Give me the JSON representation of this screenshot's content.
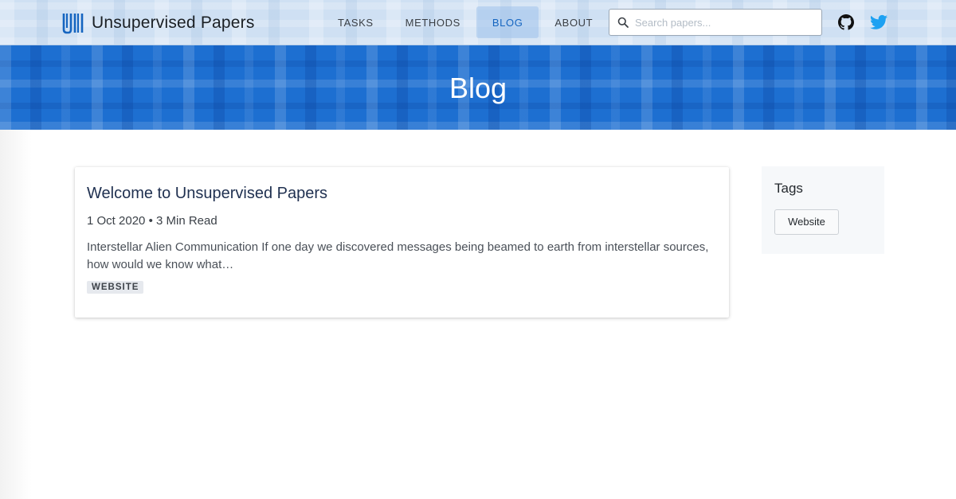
{
  "brand": {
    "name": "Unsupervised Papers",
    "accent_color": "#1565c0"
  },
  "nav": {
    "items": [
      {
        "label": "TASKS",
        "active": false
      },
      {
        "label": "METHODS",
        "active": false
      },
      {
        "label": "BLOG",
        "active": true
      },
      {
        "label": "ABOUT",
        "active": false
      }
    ]
  },
  "search": {
    "placeholder": "Search papers...",
    "value": ""
  },
  "social": {
    "icons": [
      "github-icon",
      "twitter-icon"
    ],
    "twitter_color": "#1da1f2"
  },
  "hero": {
    "title": "Blog",
    "background_color": "#1d6fd1"
  },
  "posts": [
    {
      "title": "Welcome to Unsupervised Papers",
      "date": "1 Oct 2020",
      "read_time": "3 Min Read",
      "excerpt": "Interstellar Alien Communication If one day we discovered messages being beamed to earth from interstellar sources, how would we know what…",
      "tag": "WEBSITE"
    }
  ],
  "sidebar": {
    "tags_title": "Tags",
    "tags": [
      "Website"
    ]
  }
}
